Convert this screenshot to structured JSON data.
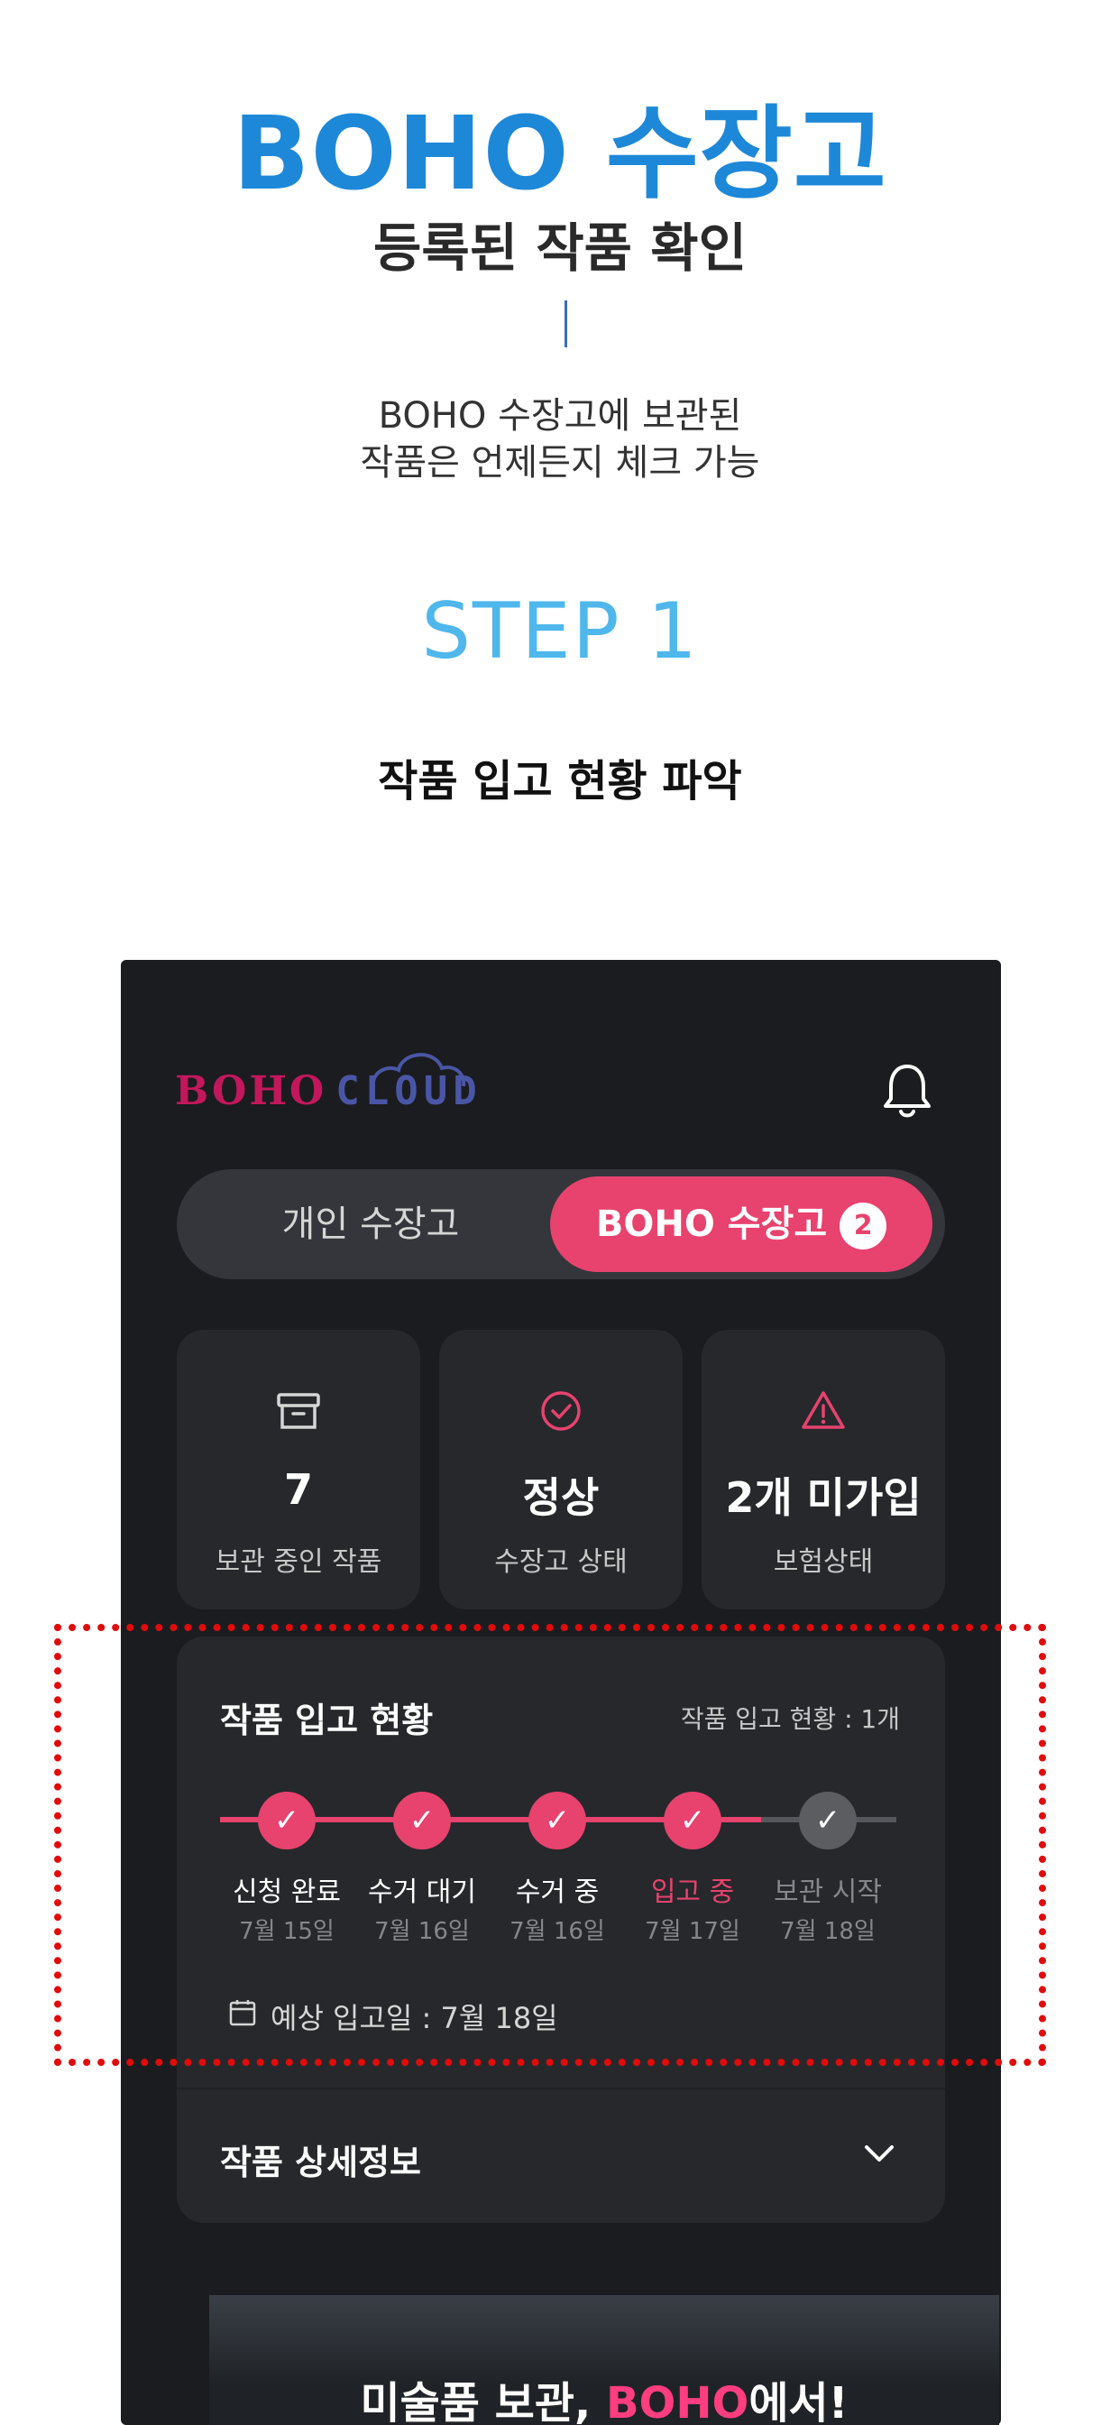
{
  "header": {
    "brand_title": "BOHO 수장고",
    "subtitle": "등록된 작품 확인",
    "desc_line1": "BOHO 수장고에 보관된",
    "desc_line2": "작품은 언제든지 체크 가능",
    "step_label": "STEP 1",
    "step_desc": "작품 입고 현황 파악"
  },
  "app": {
    "logo_boho": "BOHO",
    "logo_cloud": "CLOUD",
    "segment": {
      "left_label": "개인 수장고",
      "right_label": "BOHO 수장고",
      "right_badge": "2"
    },
    "stats": [
      {
        "icon": "archive-box-icon",
        "value": "7",
        "label": "보관 중인 작품"
      },
      {
        "icon": "check-circle-icon",
        "value": "정상",
        "label": "수장고 상태"
      },
      {
        "icon": "warning-triangle-icon",
        "value": "2개 미가입",
        "label": "보험상태"
      }
    ],
    "status": {
      "title": "작품 입고 현황",
      "count_text": "작품 입고 현황 : 1개",
      "steps": [
        {
          "name": "신청 완료",
          "date": "7월 15일",
          "state": "done"
        },
        {
          "name": "수거 대기",
          "date": "7월 16일",
          "state": "done"
        },
        {
          "name": "수거 중",
          "date": "7월 16일",
          "state": "done"
        },
        {
          "name": "입고 중",
          "date": "7월 17일",
          "state": "current"
        },
        {
          "name": "보관 시작",
          "date": "7월 18일",
          "state": "pending"
        }
      ],
      "eta_text": "예상 입고일 : 7월 18일",
      "detail_title": "작품 상세정보"
    },
    "banner": {
      "text_prefix": "미술품 보관, ",
      "text_brand": "BOHO",
      "text_suffix": "에서!"
    }
  },
  "colors": {
    "brand_blue": "#1e88d8",
    "step_blue": "#4fb7ec",
    "accent_pink": "#e8426e",
    "phone_bg": "#1b1c1f",
    "card_bg": "#26282c",
    "highlight_red": "#e20b0b"
  }
}
